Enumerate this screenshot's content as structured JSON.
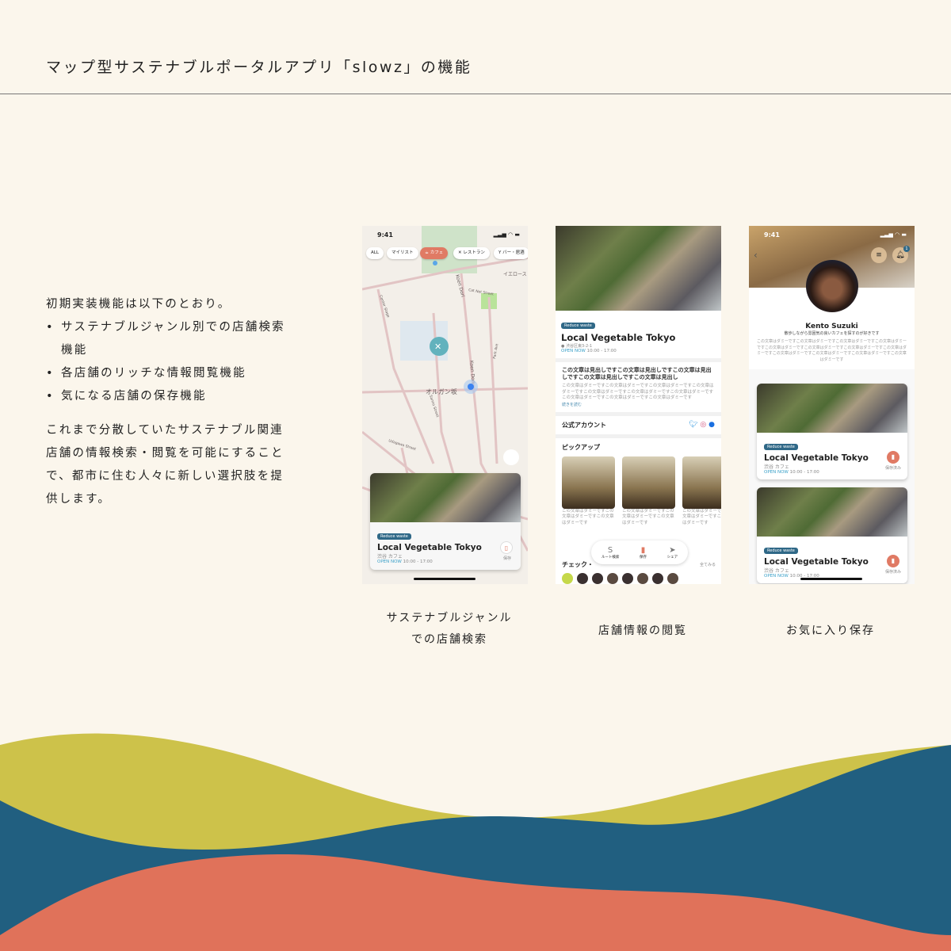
{
  "header": {
    "title": "マップ型サステナブルポータルアプリ「slowz」の機能"
  },
  "description": {
    "intro": "初期実装機能は以下のとおり。",
    "features": [
      "サステナブルジャンル別での店舗検索機能",
      "各店舗のリッチな情報閲覧機能",
      "気になる店舗の保存機能"
    ],
    "body": "これまで分散していたサステナブル関連店舗の情報検索・閲覧を可能にすることで、都市に住む人々に新しい選択肢を提供します。"
  },
  "colors": {
    "background": "#fbf6ec",
    "accent": "#e07a64",
    "tag": "#2f6887",
    "wave_yellow": "#cdc24a",
    "wave_blue": "#215f80",
    "wave_coral": "#e0725a"
  },
  "screens": [
    {
      "caption": [
        "サステナブルジャンル",
        "での店舗検索"
      ],
      "time": "9:41",
      "filters": [
        {
          "label": "ALL"
        },
        {
          "label": "マイリスト"
        },
        {
          "label": "カフェ",
          "active": true,
          "icon": "cup-icon"
        },
        {
          "label": "レストラン",
          "icon": "cutlery-icon"
        },
        {
          "label": "バー・居酒",
          "icon": "cocktail-icon"
        }
      ],
      "map_labels": [
        "Koen Dori",
        "Cat Net Street",
        "イエロース",
        "Center Stage",
        "Park Ave",
        "オルガン坂",
        "Koen Dori",
        "Udagawa Street",
        "Sanno Street"
      ],
      "card": {
        "tag": "Reduce waste",
        "name": "Local Vegetable Tokyo",
        "meta": "渋谷 カフェ",
        "open": "OPEN NOW",
        "hours": "10:00 - 17:00",
        "save": "保存"
      }
    },
    {
      "caption": [
        "店舗情報の閲覧"
      ],
      "tag": "Reduce waste",
      "name": "Local Vegetable Tokyo",
      "address": "渋谷区東3-2-1",
      "open": "OPEN NOW",
      "hours": "10:00 - 17:00",
      "heading": "この文章は見出しですこの文章は見出しですこの文章は見出しですこの文章は見出しですこの文章は見出し",
      "body": "この文章はダミーですこの文章はダミーですこの文章はダミーですこの文章はダミーですこの文章はダミーですこの文章はダミーですこの文章はダミーですこの文章はダミーですこの文章はダミーですこの文章はダミーです",
      "read_more": "続きを読む",
      "official": "公式アカウント",
      "pickup": "ピックアップ",
      "pickup_text": "この文章はダミーですこの文章はダミーですこの文章はダミーです",
      "checkin": "チェック・",
      "see_all": "全てみる",
      "actions": [
        "ルート検索",
        "保存",
        "シェア"
      ]
    },
    {
      "caption": [
        "お気に入り保存"
      ],
      "time": "9:41",
      "badge": "1",
      "user": "Kento Suzuki",
      "bio": "散歩しながら雰囲気の良いカフェを探すのが好きです",
      "body": "この文章はダミーですこの文章はダミーですこの文章はダミーですこの文章はダミーですこの文章はダミーですこの文章はダミーですこの文章はダミーですこの文章はダミーですこの文章はダミーですこの文章はダミーですこの文章はダミーですこの文章はダミーです",
      "cards": [
        {
          "tag": "Reduce waste",
          "name": "Local Vegetable Tokyo",
          "meta": "渋谷 カフェ",
          "open": "OPEN NOW",
          "hours": "10:00 - 17:00",
          "save": "保存済み"
        },
        {
          "tag": "Reduce waste",
          "name": "Local Vegetable Tokyo",
          "meta": "渋谷 カフェ",
          "open": "OPEN NOW",
          "hours": "10:00 - 17:00",
          "save": "保存済み"
        }
      ]
    }
  ]
}
